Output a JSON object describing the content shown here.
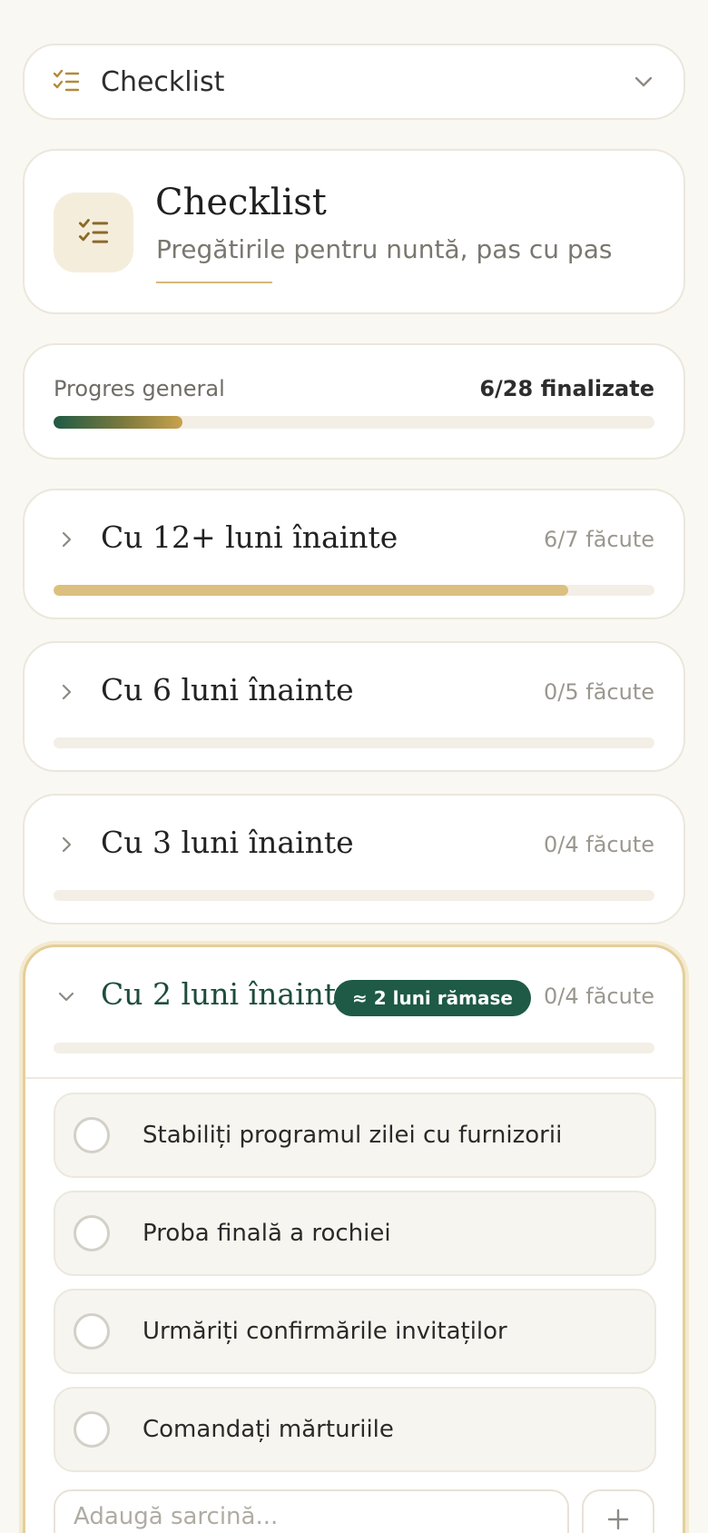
{
  "selector": {
    "label": "Checklist"
  },
  "header": {
    "title": "Checklist",
    "subtitle": "Pregătirile pentru nuntă, pas cu pas"
  },
  "progress": {
    "label": "Progres general",
    "count_text": "6/28 finalizate",
    "done": 6,
    "total": 28
  },
  "sections": [
    {
      "title": "Cu 12+ luni înainte",
      "count_text": "6/7 făcute",
      "done": 6,
      "total": 7,
      "expanded": false
    },
    {
      "title": "Cu 6 luni înainte",
      "count_text": "0/5 făcute",
      "done": 0,
      "total": 5,
      "expanded": false
    },
    {
      "title": "Cu 3 luni înainte",
      "count_text": "0/4 făcute",
      "done": 0,
      "total": 4,
      "expanded": false
    },
    {
      "title": "Cu 2 luni înainte",
      "badge": "≈ 2 luni rămase",
      "count_text": "0/4 făcute",
      "done": 0,
      "total": 4,
      "expanded": true,
      "tasks": [
        "Stabiliți programul zilei cu furnizorii",
        "Proba finală a rochiei",
        "Urmăriți confirmările invitaților",
        "Comandați mărturiile"
      ],
      "add_placeholder": "Adaugă sarcină..."
    }
  ],
  "colors": {
    "accent_green": "#1e5a45",
    "accent_gold": "#dcc07f",
    "background": "#faf8f3"
  },
  "icons": {
    "selector": "checklist-icon",
    "selector_toggle": "chevron-down-icon",
    "collapsed": "chevron-right-icon",
    "expanded": "chevron-down-icon",
    "add": "plus-icon"
  }
}
